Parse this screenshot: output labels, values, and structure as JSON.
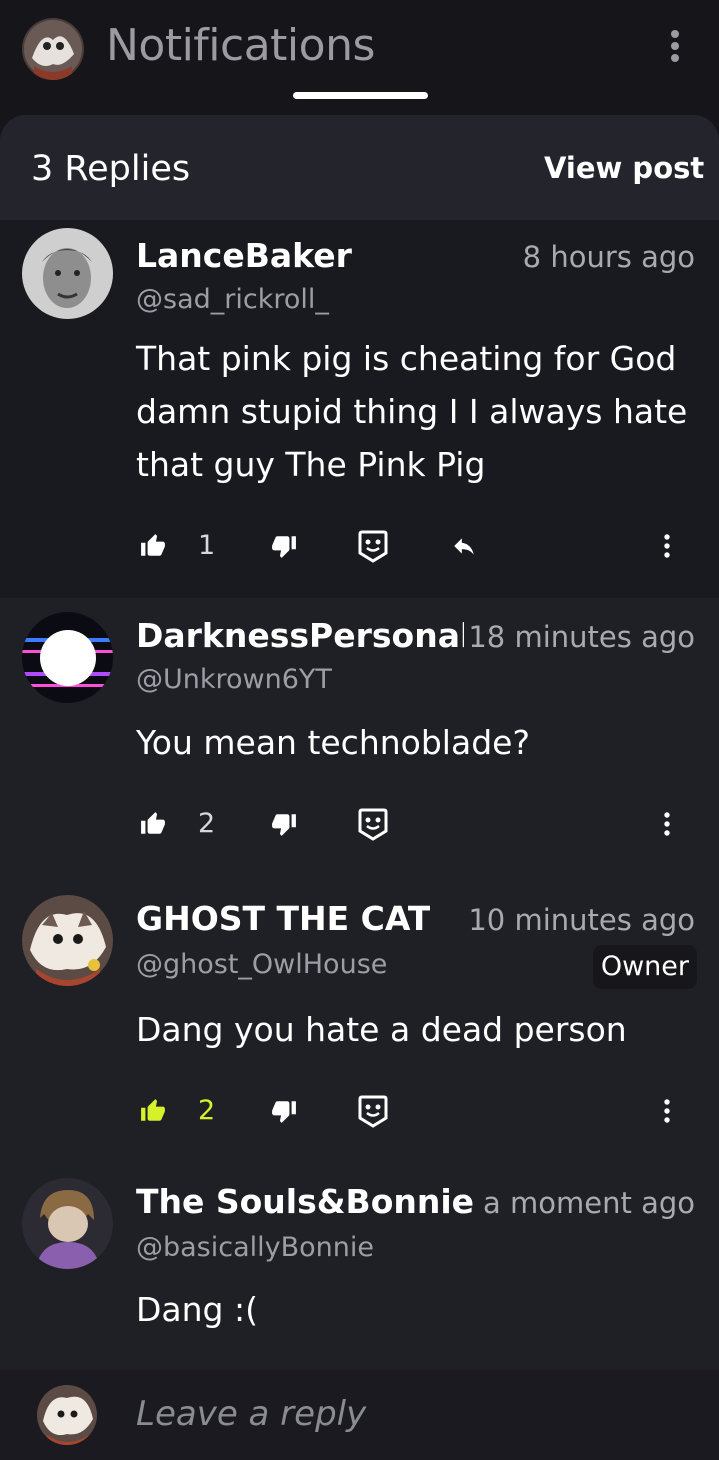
{
  "header": {
    "title": "Notifications",
    "more_icon": "more-vertical-icon"
  },
  "thread": {
    "replies_label": "3 Replies",
    "view_post_label": "View post"
  },
  "comments": [
    {
      "name": "LanceBaker",
      "time": "8 hours ago",
      "handle": "@sad_rickroll_",
      "text": "That pink pig is cheating for God damn stupid thing I I always hate that guy The Pink Pig",
      "likes": "1",
      "liked": false,
      "badge": ""
    },
    {
      "name": "DarknessPersonalit",
      "time": "18 minutes ago",
      "handle": "@Unkrown6YT",
      "text": "You mean technoblade?",
      "likes": "2",
      "liked": false,
      "badge": ""
    },
    {
      "name": "GHOST THE CAT",
      "time": "10 minutes ago",
      "handle": "@ghost_OwlHouse",
      "text": "Dang you hate a dead person",
      "likes": "2",
      "liked": true,
      "badge": "Owner"
    },
    {
      "name": "The Souls&Bonnie",
      "time": "a moment ago",
      "handle": "@basicallyBonnie",
      "text": "Dang :(",
      "likes": "",
      "liked": false,
      "badge": ""
    }
  ],
  "reply_input": {
    "placeholder": "Leave a reply"
  },
  "colors": {
    "background": "#16161a",
    "sheet": "#1f1f26",
    "liked_accent": "#d6f02a",
    "muted_text": "#a9a9b0"
  }
}
